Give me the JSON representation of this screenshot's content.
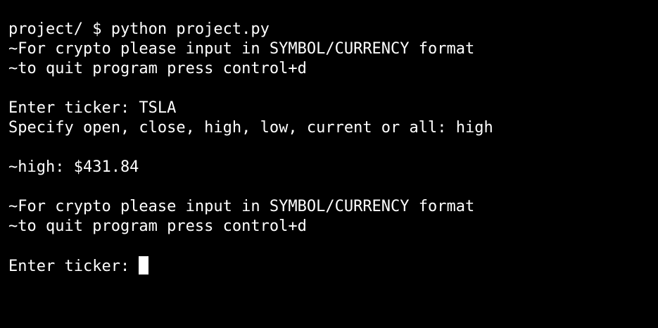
{
  "terminal": {
    "lines": {
      "command": "project/ $ python project.py",
      "crypto_hint_1": "~For crypto please input in SYMBOL/CURRENCY format",
      "quit_hint_1": "~to quit program press control+d",
      "ticker_prompt_1": "Enter ticker: TSLA",
      "specify_prompt": "Specify open, close, high, low, current or all: high",
      "result": "~high: $431.84",
      "crypto_hint_2": "~For crypto please input in SYMBOL/CURRENCY format",
      "quit_hint_2": "~to quit program press control+d",
      "ticker_prompt_2": "Enter ticker: "
    },
    "colors": {
      "background": "#000000",
      "foreground": "#ffffff"
    }
  }
}
